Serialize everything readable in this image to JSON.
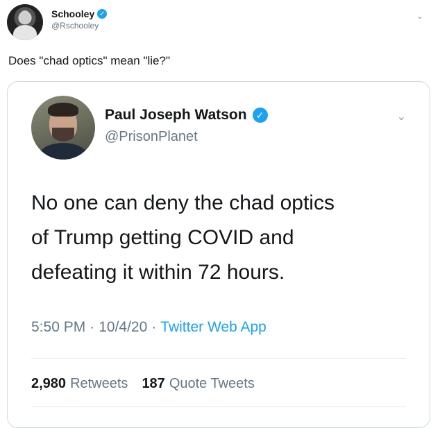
{
  "outer_tweet": {
    "name": "Schooley",
    "handle": "@Rschooley",
    "text": "Does \"chad optics\" mean \"lie?\""
  },
  "quoted_tweet": {
    "name": "Paul Joseph Watson",
    "handle": "@PrisonPlanet",
    "text_lines": [
      "No one can deny the chad optics",
      "of Trump getting COVID and",
      "defeating it within 72 hours."
    ],
    "time": "5:50 PM",
    "date": "10/4/20",
    "separator": "·",
    "source": "Twitter Web App",
    "retweets_count": "2,980",
    "retweets_label": "Retweets",
    "quote_tweets_count": "187",
    "quote_tweets_label": "Quote Tweets"
  },
  "icons": {
    "verified": "✓",
    "chevron": "⌄"
  },
  "colors": {
    "accent": "#1da1f2",
    "secondary_text": "#657786",
    "primary_text": "#14171a"
  }
}
